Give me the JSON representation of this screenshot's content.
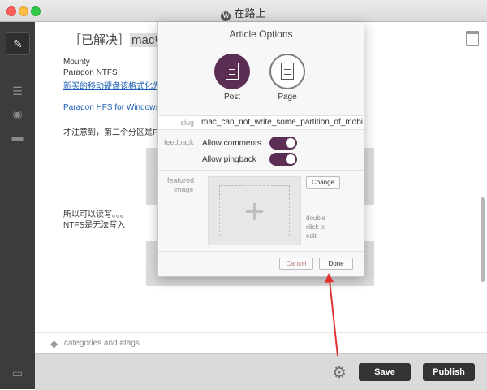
{
  "window": {
    "title": "在路上",
    "wp_icon": "wordpress-icon"
  },
  "sidebar": {
    "items": [
      "compose-icon",
      "list-icon",
      "eye-icon",
      "comment-icon",
      "folder-icon"
    ]
  },
  "editor": {
    "title_prefix": "［已解决］",
    "title_highlight": "mac中无",
    "lines": [
      "Mounty",
      " Paragon NTFS",
      "新买的移动硬盘该格式化为",
      "Paragon HFS for Windows",
      "才注意到，第二个分区是FA",
      "所以可以读写。。。",
      "NTFS是无法写入"
    ],
    "tags_placeholder": "categories and #tags"
  },
  "bottom": {
    "save_label": "Save",
    "publish_label": "Publish"
  },
  "article_options": {
    "title": "Article Options",
    "post_label": "Post",
    "page_label": "Page",
    "slug_label": "slug",
    "slug_value": "mac_can_not_write_some_partition_of_mobile_",
    "feedback_label": "feedback",
    "allow_comments_label": "Allow comments",
    "allow_pingback_label": "Allow pingback",
    "allow_comments": true,
    "allow_pingback": true,
    "featured_label_1": "featured",
    "featured_label_2": "image",
    "change_label": "Change",
    "hint_1": "double",
    "hint_2": "click to",
    "hint_3": "edit",
    "cancel_label": "Cancel",
    "done_label": "Done"
  },
  "colors": {
    "accent": "#5d2e53",
    "annotation_arrow": "#e0332f"
  }
}
